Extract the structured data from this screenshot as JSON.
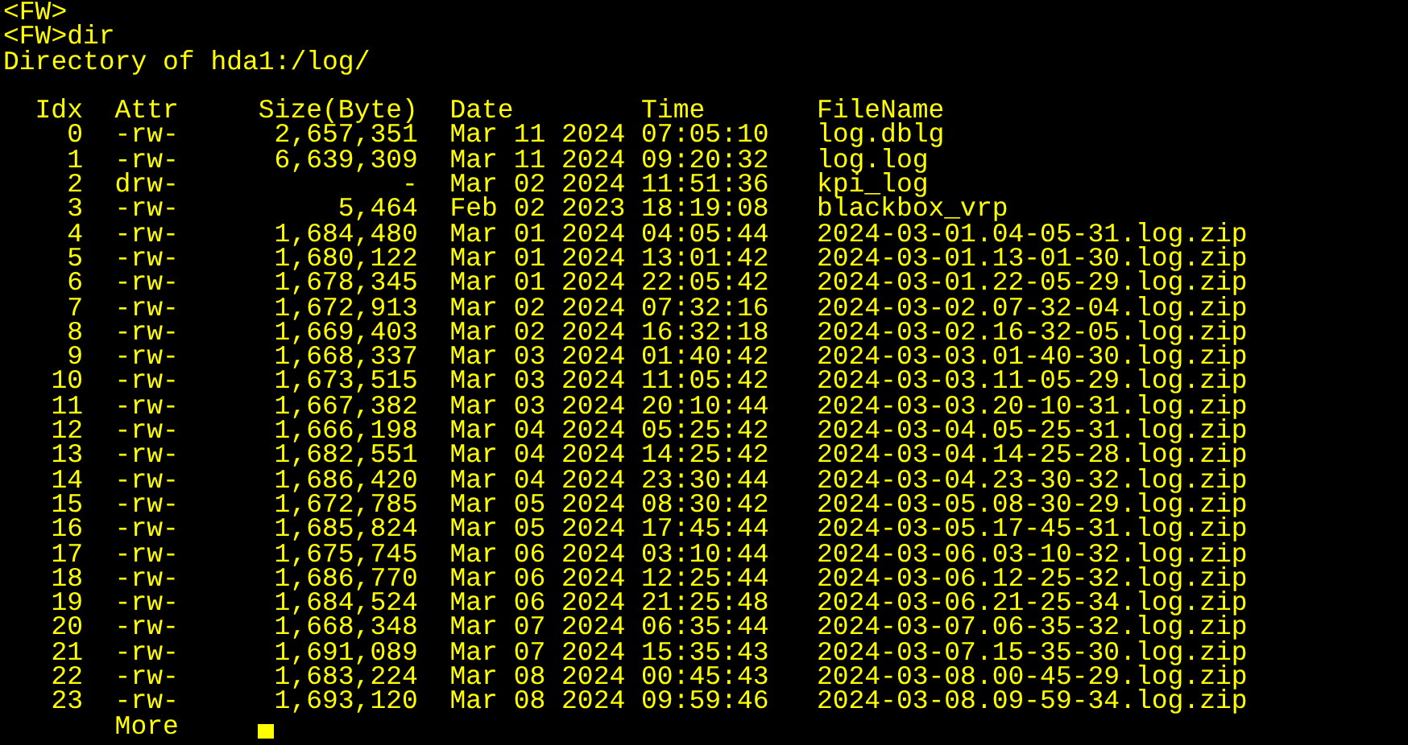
{
  "terminal": {
    "lines": [
      "<FW>",
      "<FW>dir",
      "Directory of hda1:/log/"
    ],
    "table": {
      "columns": [
        "Idx",
        "Attr",
        "Size(Byte)",
        "Date",
        "Time",
        "FileName"
      ],
      "rows": [
        [
          "0",
          "-rw-",
          "2,657,351",
          "Mar 11 2024",
          "07:05:10",
          "log.dblg"
        ],
        [
          "1",
          "-rw-",
          "6,639,309",
          "Mar 11 2024",
          "09:20:32",
          "log.log"
        ],
        [
          "2",
          "drw-",
          "-",
          "Mar 02 2024",
          "11:51:36",
          "kpi_log"
        ],
        [
          "3",
          "-rw-",
          "5,464",
          "Feb 02 2023",
          "18:19:08",
          "blackbox_vrp"
        ],
        [
          "4",
          "-rw-",
          "1,684,480",
          "Mar 01 2024",
          "04:05:44",
          "2024-03-01.04-05-31.log.zip"
        ],
        [
          "5",
          "-rw-",
          "1,680,122",
          "Mar 01 2024",
          "13:01:42",
          "2024-03-01.13-01-30.log.zip"
        ],
        [
          "6",
          "-rw-",
          "1,678,345",
          "Mar 01 2024",
          "22:05:42",
          "2024-03-01.22-05-29.log.zip"
        ],
        [
          "7",
          "-rw-",
          "1,672,913",
          "Mar 02 2024",
          "07:32:16",
          "2024-03-02.07-32-04.log.zip"
        ],
        [
          "8",
          "-rw-",
          "1,669,403",
          "Mar 02 2024",
          "16:32:18",
          "2024-03-02.16-32-05.log.zip"
        ],
        [
          "9",
          "-rw-",
          "1,668,337",
          "Mar 03 2024",
          "01:40:42",
          "2024-03-03.01-40-30.log.zip"
        ],
        [
          "10",
          "-rw-",
          "1,673,515",
          "Mar 03 2024",
          "11:05:42",
          "2024-03-03.11-05-29.log.zip"
        ],
        [
          "11",
          "-rw-",
          "1,667,382",
          "Mar 03 2024",
          "20:10:44",
          "2024-03-03.20-10-31.log.zip"
        ],
        [
          "12",
          "-rw-",
          "1,666,198",
          "Mar 04 2024",
          "05:25:42",
          "2024-03-04.05-25-31.log.zip"
        ],
        [
          "13",
          "-rw-",
          "1,682,551",
          "Mar 04 2024",
          "14:25:42",
          "2024-03-04.14-25-28.log.zip"
        ],
        [
          "14",
          "-rw-",
          "1,686,420",
          "Mar 04 2024",
          "23:30:44",
          "2024-03-04.23-30-32.log.zip"
        ],
        [
          "15",
          "-rw-",
          "1,672,785",
          "Mar 05 2024",
          "08:30:42",
          "2024-03-05.08-30-29.log.zip"
        ],
        [
          "16",
          "-rw-",
          "1,685,824",
          "Mar 05 2024",
          "17:45:44",
          "2024-03-05.17-45-31.log.zip"
        ],
        [
          "17",
          "-rw-",
          "1,675,745",
          "Mar 06 2024",
          "03:10:44",
          "2024-03-06.03-10-32.log.zip"
        ],
        [
          "18",
          "-rw-",
          "1,686,770",
          "Mar 06 2024",
          "12:25:44",
          "2024-03-06.12-25-32.log.zip"
        ],
        [
          "19",
          "-rw-",
          "1,684,524",
          "Mar 06 2024",
          "21:25:48",
          "2024-03-06.21-25-34.log.zip"
        ],
        [
          "20",
          "-rw-",
          "1,668,348",
          "Mar 07 2024",
          "06:35:44",
          "2024-03-07.06-35-32.log.zip"
        ],
        [
          "21",
          "-rw-",
          "1,691,089",
          "Mar 07 2024",
          "15:35:43",
          "2024-03-07.15-35-30.log.zip"
        ],
        [
          "22",
          "-rw-",
          "1,683,224",
          "Mar 08 2024",
          "00:45:43",
          "2024-03-08.00-45-29.log.zip"
        ],
        [
          "23",
          "-rw-",
          "1,693,120",
          "Mar 08 2024",
          "09:59:46",
          "2024-03-08.09-59-34.log.zip"
        ]
      ]
    },
    "more": "More"
  }
}
